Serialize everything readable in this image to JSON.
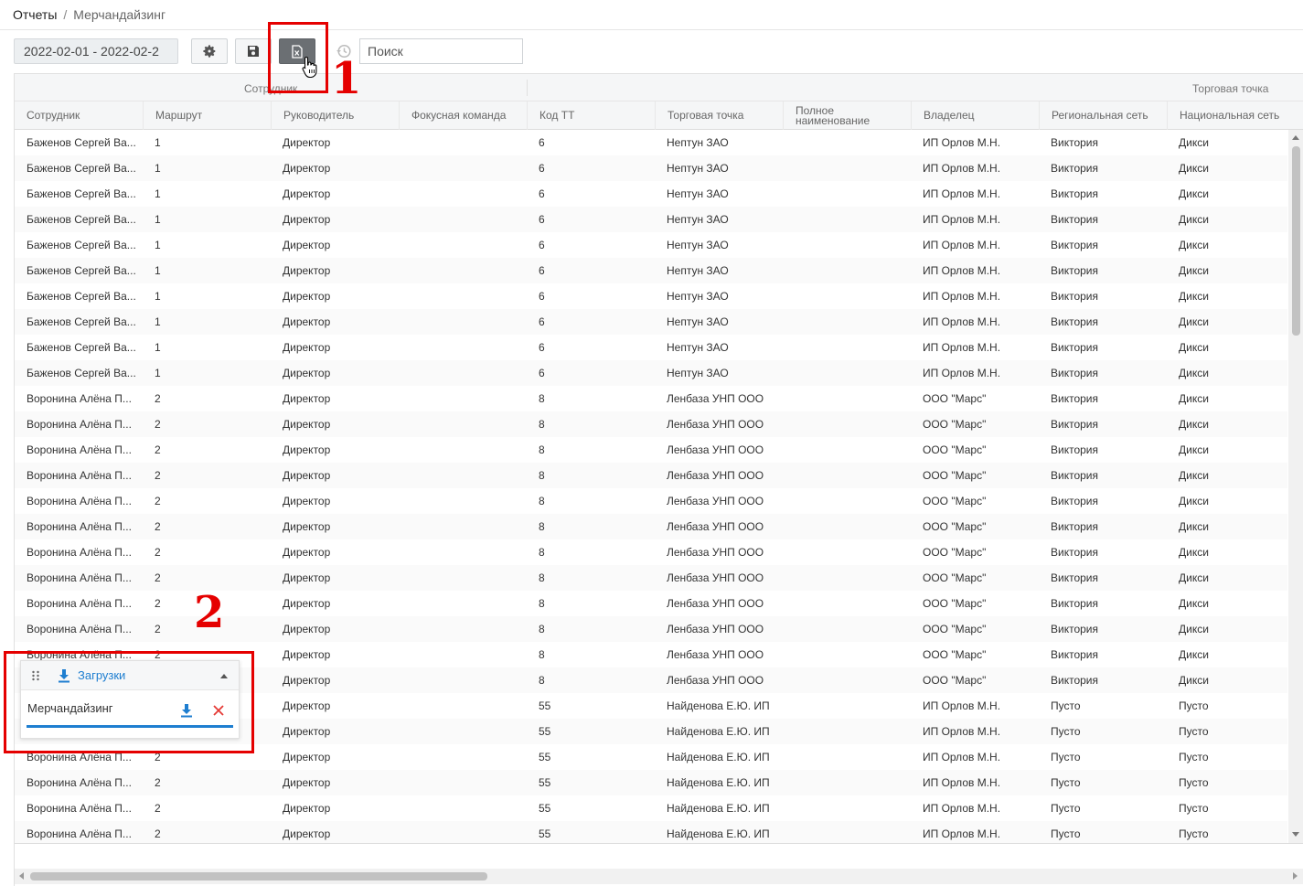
{
  "breadcrumb": {
    "root": "Отчеты",
    "separator": "/",
    "current": "Мерчандайзинг"
  },
  "toolbar": {
    "date_range": "2022-02-01 - 2022-02-2",
    "search_placeholder": "Поиск",
    "icons": [
      "gear-icon",
      "save-icon",
      "excel-export-icon",
      "history-icon"
    ]
  },
  "grid": {
    "group_headers": {
      "left": "Сотрудник",
      "right": "Торговая точка"
    },
    "columns": [
      "Сотрудник",
      "Маршрут",
      "Руководитель",
      "Фокусная команда",
      "Код ТТ",
      "Торговая точка",
      "Полное наименование",
      "Владелец",
      "Региональная сеть",
      "Национальная сеть"
    ],
    "rows": [
      [
        "Баженов Сергей Ва...",
        "1",
        "Директор",
        "",
        "6",
        "Нептун ЗАО",
        "",
        "ИП Орлов М.Н.",
        "Виктория",
        "Дикси"
      ],
      [
        "Баженов Сергей Ва...",
        "1",
        "Директор",
        "",
        "6",
        "Нептун ЗАО",
        "",
        "ИП Орлов М.Н.",
        "Виктория",
        "Дикси"
      ],
      [
        "Баженов Сергей Ва...",
        "1",
        "Директор",
        "",
        "6",
        "Нептун ЗАО",
        "",
        "ИП Орлов М.Н.",
        "Виктория",
        "Дикси"
      ],
      [
        "Баженов Сергей Ва...",
        "1",
        "Директор",
        "",
        "6",
        "Нептун ЗАО",
        "",
        "ИП Орлов М.Н.",
        "Виктория",
        "Дикси"
      ],
      [
        "Баженов Сергей Ва...",
        "1",
        "Директор",
        "",
        "6",
        "Нептун ЗАО",
        "",
        "ИП Орлов М.Н.",
        "Виктория",
        "Дикси"
      ],
      [
        "Баженов Сергей Ва...",
        "1",
        "Директор",
        "",
        "6",
        "Нептун ЗАО",
        "",
        "ИП Орлов М.Н.",
        "Виктория",
        "Дикси"
      ],
      [
        "Баженов Сергей Ва...",
        "1",
        "Директор",
        "",
        "6",
        "Нептун ЗАО",
        "",
        "ИП Орлов М.Н.",
        "Виктория",
        "Дикси"
      ],
      [
        "Баженов Сергей Ва...",
        "1",
        "Директор",
        "",
        "6",
        "Нептун ЗАО",
        "",
        "ИП Орлов М.Н.",
        "Виктория",
        "Дикси"
      ],
      [
        "Баженов Сергей Ва...",
        "1",
        "Директор",
        "",
        "6",
        "Нептун ЗАО",
        "",
        "ИП Орлов М.Н.",
        "Виктория",
        "Дикси"
      ],
      [
        "Баженов Сергей Ва...",
        "1",
        "Директор",
        "",
        "6",
        "Нептун ЗАО",
        "",
        "ИП Орлов М.Н.",
        "Виктория",
        "Дикси"
      ],
      [
        "Воронина Алёна П...",
        "2",
        "Директор",
        "",
        "8",
        "Ленбаза УНП ООО",
        "",
        "ООО \"Марс\"",
        "Виктория",
        "Дикси"
      ],
      [
        "Воронина Алёна П...",
        "2",
        "Директор",
        "",
        "8",
        "Ленбаза УНП ООО",
        "",
        "ООО \"Марс\"",
        "Виктория",
        "Дикси"
      ],
      [
        "Воронина Алёна П...",
        "2",
        "Директор",
        "",
        "8",
        "Ленбаза УНП ООО",
        "",
        "ООО \"Марс\"",
        "Виктория",
        "Дикси"
      ],
      [
        "Воронина Алёна П...",
        "2",
        "Директор",
        "",
        "8",
        "Ленбаза УНП ООО",
        "",
        "ООО \"Марс\"",
        "Виктория",
        "Дикси"
      ],
      [
        "Воронина Алёна П...",
        "2",
        "Директор",
        "",
        "8",
        "Ленбаза УНП ООО",
        "",
        "ООО \"Марс\"",
        "Виктория",
        "Дикси"
      ],
      [
        "Воронина Алёна П...",
        "2",
        "Директор",
        "",
        "8",
        "Ленбаза УНП ООО",
        "",
        "ООО \"Марс\"",
        "Виктория",
        "Дикси"
      ],
      [
        "Воронина Алёна П...",
        "2",
        "Директор",
        "",
        "8",
        "Ленбаза УНП ООО",
        "",
        "ООО \"Марс\"",
        "Виктория",
        "Дикси"
      ],
      [
        "Воронина Алёна П...",
        "2",
        "Директор",
        "",
        "8",
        "Ленбаза УНП ООО",
        "",
        "ООО \"Марс\"",
        "Виктория",
        "Дикси"
      ],
      [
        "Воронина Алёна П...",
        "2",
        "Директор",
        "",
        "8",
        "Ленбаза УНП ООО",
        "",
        "ООО \"Марс\"",
        "Виктория",
        "Дикси"
      ],
      [
        "Воронина Алёна П...",
        "2",
        "Директор",
        "",
        "8",
        "Ленбаза УНП ООО",
        "",
        "ООО \"Марс\"",
        "Виктория",
        "Дикси"
      ],
      [
        "Воронина Алёна П...",
        "2",
        "Директор",
        "",
        "8",
        "Ленбаза УНП ООО",
        "",
        "ООО \"Марс\"",
        "Виктория",
        "Дикси"
      ],
      [
        "Воронина Алёна П...",
        "2",
        "Директор",
        "",
        "8",
        "Ленбаза УНП ООО",
        "",
        "ООО \"Марс\"",
        "Виктория",
        "Дикси"
      ],
      [
        "Воронина Алёна П...",
        "2",
        "Директор",
        "",
        "55",
        "Найденова Е.Ю. ИП",
        "",
        "ИП Орлов М.Н.",
        "Пусто",
        "Пусто"
      ],
      [
        "Воронина Алёна П...",
        "2",
        "Директор",
        "",
        "55",
        "Найденова Е.Ю. ИП",
        "",
        "ИП Орлов М.Н.",
        "Пусто",
        "Пусто"
      ],
      [
        "Воронина Алёна П...",
        "2",
        "Директор",
        "",
        "55",
        "Найденова Е.Ю. ИП",
        "",
        "ИП Орлов М.Н.",
        "Пусто",
        "Пусто"
      ],
      [
        "Воронина Алёна П...",
        "2",
        "Директор",
        "",
        "55",
        "Найденова Е.Ю. ИП",
        "",
        "ИП Орлов М.Н.",
        "Пусто",
        "Пусто"
      ],
      [
        "Воронина Алёна П...",
        "2",
        "Директор",
        "",
        "55",
        "Найденова Е.Ю. ИП",
        "",
        "ИП Орлов М.Н.",
        "Пусто",
        "Пусто"
      ],
      [
        "Воронина Алёна П...",
        "2",
        "Директор",
        "",
        "55",
        "Найденова Е.Ю. ИП",
        "",
        "ИП Орлов М.Н.",
        "Пусто",
        "Пусто"
      ]
    ]
  },
  "downloads": {
    "title": "Загрузки",
    "item": "Мерчандайзинг",
    "progress": 1.0
  },
  "annotations": {
    "label_1": "1",
    "label_2": "2",
    "color": "#e50000"
  },
  "colors": {
    "accent": "#1e7ed0",
    "delete": "#e53935",
    "annotation": "#e50000"
  }
}
